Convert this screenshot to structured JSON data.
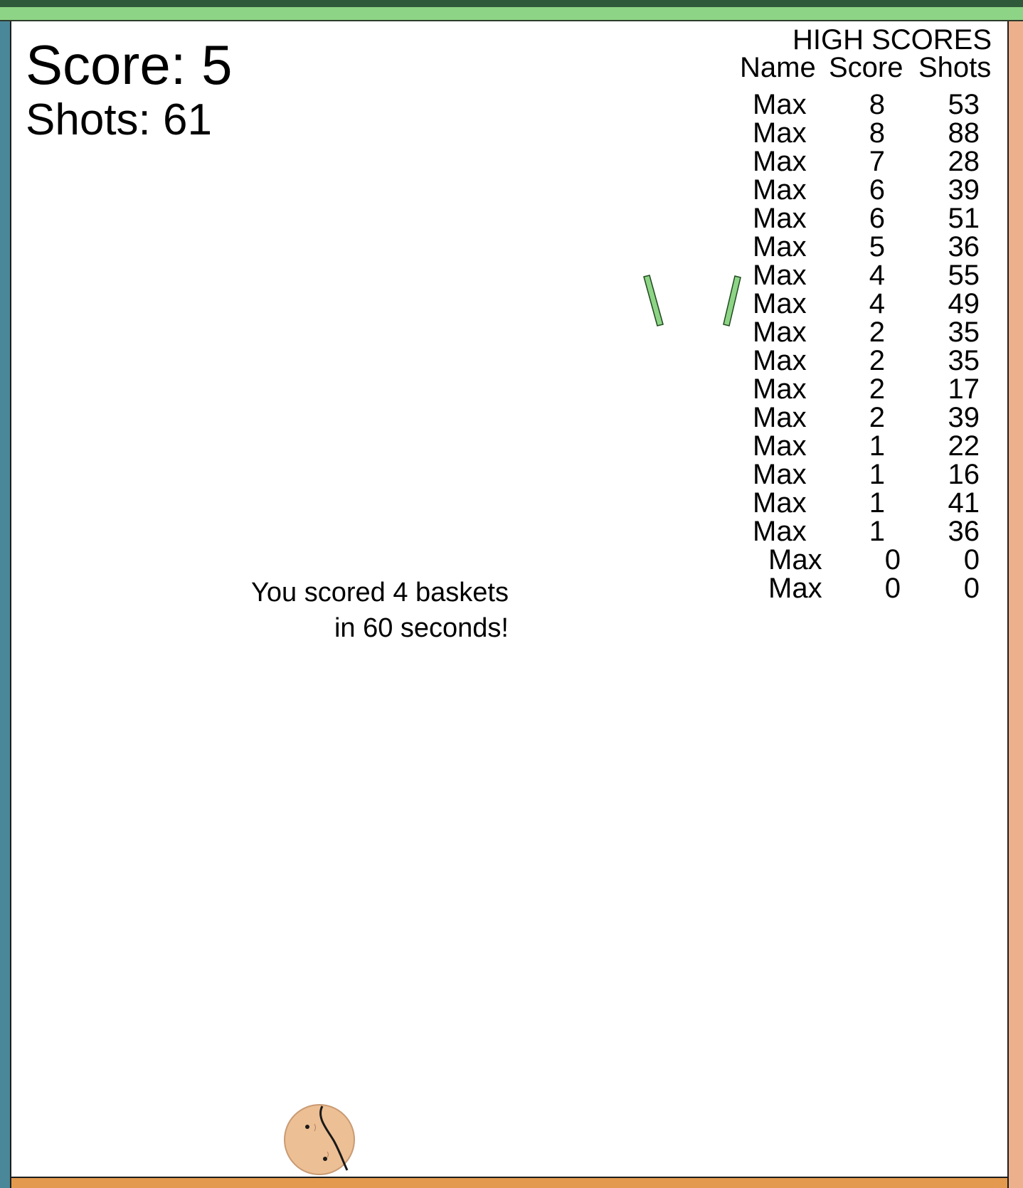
{
  "hud": {
    "score_label": "Score:",
    "score_value": "5",
    "shots_label": "Shots:",
    "shots_value": "61"
  },
  "high_scores": {
    "title": "HIGH SCORES",
    "col_name": "Name",
    "col_score": "Score",
    "col_shots": "Shots",
    "entries": [
      {
        "name": "Max",
        "score": "8",
        "shots": "53"
      },
      {
        "name": "Max",
        "score": "8",
        "shots": "88"
      },
      {
        "name": "Max",
        "score": "7",
        "shots": "28"
      },
      {
        "name": "Max",
        "score": "6",
        "shots": "39"
      },
      {
        "name": "Max",
        "score": "6",
        "shots": "51"
      },
      {
        "name": "Max",
        "score": "5",
        "shots": "36"
      },
      {
        "name": "Max",
        "score": "4",
        "shots": "55"
      },
      {
        "name": "Max",
        "score": "4",
        "shots": "49"
      },
      {
        "name": "Max",
        "score": "2",
        "shots": "35"
      },
      {
        "name": "Max",
        "score": "2",
        "shots": "35"
      },
      {
        "name": "Max",
        "score": "2",
        "shots": "17"
      },
      {
        "name": "Max",
        "score": "2",
        "shots": "39"
      },
      {
        "name": "Max",
        "score": "1",
        "shots": "22"
      },
      {
        "name": "Max",
        "score": "1",
        "shots": "16"
      },
      {
        "name": "Max",
        "score": "1",
        "shots": "41"
      },
      {
        "name": "Max",
        "score": "1",
        "shots": "36"
      },
      {
        "name": "Max",
        "score": "0",
        "shots": "0"
      },
      {
        "name": "Max",
        "score": "0",
        "shots": "0"
      }
    ]
  },
  "message": {
    "line1": "You scored 4 baskets",
    "line2": "in 60 seconds!"
  },
  "colors": {
    "top_bar_dark": "#2f5a3a",
    "top_bar_light": "#8ed486",
    "left_wall": "#4a8899",
    "right_wall": "#edb08c",
    "floor": "#e39a4e",
    "hoop": "#8ed486",
    "ball": "#edbf94"
  },
  "icons": {
    "hoop": "basketball-hoop-icon",
    "ball": "basketball-ball-icon"
  }
}
